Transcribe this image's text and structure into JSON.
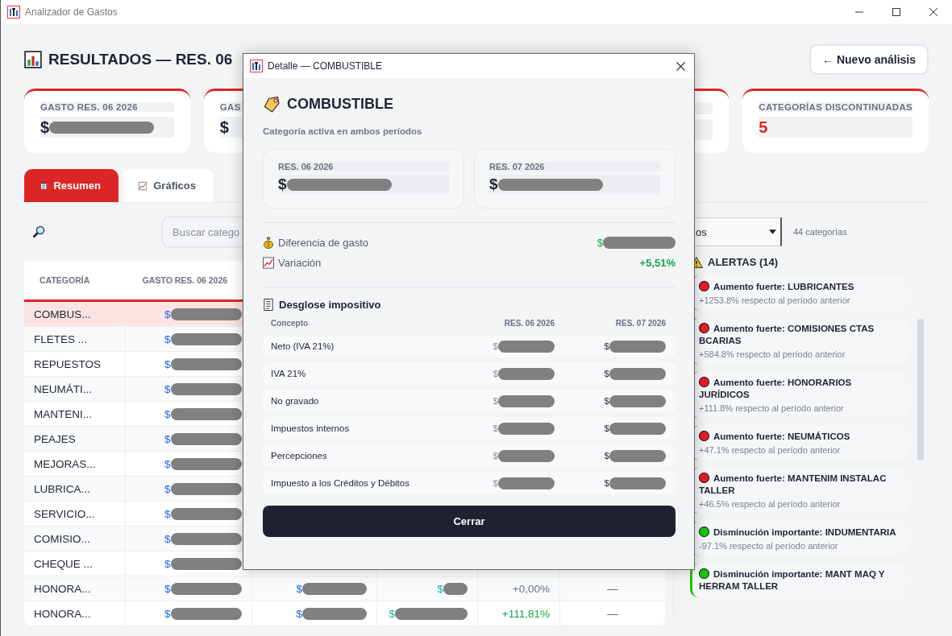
{
  "window": {
    "title": "Analizador de Gastos"
  },
  "header": {
    "title": "RESULTADOS — RES. 06",
    "new_button": "← Nuevo análisis"
  },
  "stat_cards": [
    {
      "kind": "text",
      "label": "GASTO RES. 06 2026",
      "value": {
        "text": "$",
        "redacted": true
      }
    },
    {
      "kind": "text",
      "label": "GAS",
      "value": {
        "text": "$",
        "redacted": false
      }
    },
    {
      "kind": "covered"
    },
    {
      "kind": "count",
      "label": "CATEGORÍAS DISCONTINUADAS",
      "value": {
        "text": "5",
        "redacted": false
      }
    }
  ],
  "tabs": [
    {
      "label": "Resumen",
      "selected": true
    },
    {
      "label": "Gráficos",
      "selected": false
    }
  ],
  "search": {
    "placeholder": "Buscar catego"
  },
  "filter": {
    "value": "os",
    "count": "44 categorías"
  },
  "table": {
    "columns": [
      "CATEGORÍA",
      "GASTO RES. 06 2026"
    ],
    "rows": [
      {
        "category": "COMBUS...",
        "selected": true,
        "gasto": {
          "text": "$",
          "redacted": true
        }
      },
      {
        "category": "FLETES ...",
        "selected": false,
        "gasto": {
          "text": "$",
          "redacted": true
        }
      },
      {
        "category": "REPUESTOS",
        "selected": false,
        "gasto": {
          "text": "$",
          "redacted": true
        }
      },
      {
        "category": "NEUMÁTI...",
        "selected": false,
        "gasto": {
          "text": "$",
          "redacted": true
        }
      },
      {
        "category": "MANTENI...",
        "selected": false,
        "gasto": {
          "text": "$",
          "redacted": true
        }
      },
      {
        "category": "PEAJES",
        "selected": false,
        "gasto": {
          "text": "$",
          "redacted": true
        }
      },
      {
        "category": "MEJORAS...",
        "selected": false,
        "gasto": {
          "text": "$",
          "redacted": true
        }
      },
      {
        "category": "LUBRICA...",
        "selected": false,
        "gasto": {
          "text": "$",
          "redacted": true
        }
      },
      {
        "category": "SERVICIO...",
        "selected": false,
        "gasto": {
          "text": "$",
          "redacted": true
        }
      },
      {
        "category": "COMISIO...",
        "selected": false,
        "gasto": {
          "text": "$",
          "redacted": true
        }
      },
      {
        "category": "CHEQUE ...",
        "selected": false,
        "gasto": {
          "text": "$",
          "redacted": true
        }
      },
      {
        "category": "HONORA...",
        "selected": false,
        "gasto": {
          "text": "$",
          "redacted": true
        },
        "column_3": {
          "text": "$",
          "redacted": true
        },
        "column_4": {
          "text": "$",
          "redacted": true
        },
        "column_5": "+0,00%",
        "color": "#6b7280",
        "column_6": "—"
      },
      {
        "category": "HONORA...",
        "selected": false,
        "gasto": {
          "text": "$",
          "redacted": true
        },
        "column_3": {
          "text": "$",
          "redacted": true
        },
        "column_4": {
          "text": "$",
          "redacted": true
        },
        "column_5": "+111,81%",
        "color": "#16a34a",
        "column_6": "—"
      }
    ]
  },
  "alerts": {
    "title": "ALERTAS (14)",
    "items": [
      {
        "title": "Aumento fuerte: LUBRICANTES",
        "detail": "+1253.8% respecto al período anterior",
        "color": "#e11d2a"
      },
      {
        "title": "Aumento fuerte: COMISIONES CTAS BCARIAS",
        "detail": "+584.8% respecto al período anterior",
        "color": "#e11d2a"
      },
      {
        "title": "Aumento fuerte: HONORARIOS JURÍDICOS",
        "detail": "+111.8% respecto al período anterior",
        "color": "#e11d2a"
      },
      {
        "title": "Aumento fuerte: NEUMÁTICOS",
        "detail": "+47.1% respecto al período anterior",
        "color": "#e11d2a"
      },
      {
        "title": "Aumento fuerte: MANTENIM INSTALAC TALLER",
        "detail": "+46.5% respecto al período anterior",
        "color": "#e11d2a"
      },
      {
        "title": "Disminución importante: INDUMENTARIA",
        "detail": "-97.1% respecto al período anterior",
        "color": "#16c60c"
      },
      {
        "title": "Disminución importante: MANT MAQ Y HERRAM TALLER",
        "color": "#16c60c"
      }
    ]
  },
  "dialog": {
    "title": "Detalle — COMBUSTIBLE",
    "heading": "COMBUSTIBLE",
    "subtitle": "Categoría activa en ambos períodos",
    "periods": [
      {
        "label": "RES. 06 2026",
        "value": {
          "text": "$",
          "redacted": true
        }
      },
      {
        "label": "RES. 07 2026",
        "value": {
          "text": "$",
          "redacted": true
        }
      }
    ],
    "difference": {
      "label": "Diferencia de gasto",
      "value": {
        "text": "$",
        "redacted": true
      }
    },
    "variation": {
      "label": "Variación",
      "value": "+5,51%"
    },
    "breakdown": {
      "title": "Desglose impositivo",
      "columns": [
        "Concepto",
        "RES. 06 2026",
        "RES. 07 2026"
      ],
      "rows": [
        {
          "concept": "Neto (IVA 21%)",
          "a": {
            "text": "$",
            "redacted": true
          },
          "b": {
            "text": "$",
            "redacted": true
          }
        },
        {
          "concept": "IVA 21%",
          "a": {
            "text": "$",
            "redacted": true
          },
          "b": {
            "text": "$",
            "redacted": true
          }
        },
        {
          "concept": "No gravado",
          "a": {
            "text": "$",
            "redacted": true
          },
          "b": {
            "text": "$",
            "redacted": true
          }
        },
        {
          "concept": "Impuestos internos",
          "a": {
            "text": "$",
            "redacted": true
          },
          "b": {
            "text": "$",
            "redacted": true
          }
        },
        {
          "concept": "Percepciones",
          "a": {
            "text": "$",
            "redacted": true
          },
          "b": {
            "text": "$",
            "redacted": true
          }
        },
        {
          "concept": "Impuesto a los Créditos y Débitos",
          "a": {
            "text": "$",
            "redacted": true
          },
          "b": {
            "text": "$",
            "redacted": true
          }
        }
      ]
    },
    "close_button": "Cerrar"
  }
}
